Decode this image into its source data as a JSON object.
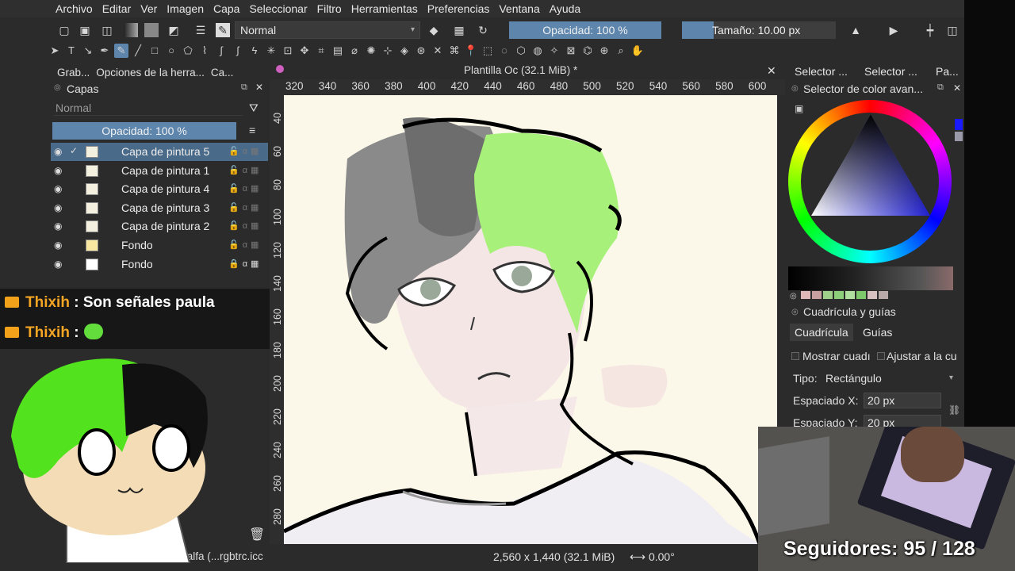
{
  "menu": [
    "Archivo",
    "Editar",
    "Ver",
    "Imagen",
    "Capa",
    "Seleccionar",
    "Filtro",
    "Herramientas",
    "Preferencias",
    "Ventana",
    "Ayuda"
  ],
  "toolbar": {
    "blend_mode": "Normal",
    "opacity_label": "Opacidad: 100 %",
    "size_label": "Tamaño: 10.00 px"
  },
  "left_tabs": [
    "Grab...",
    "Opciones de la herra...",
    "Ca..."
  ],
  "layers": {
    "title": "Capas",
    "blend_mode": "Normal",
    "opacity_label": "Opacidad:  100 %",
    "items": [
      {
        "name": "Capa de pintura 5",
        "selected": true
      },
      {
        "name": "Capa de pintura 1",
        "selected": false
      },
      {
        "name": "Capa de pintura 4",
        "selected": false
      },
      {
        "name": "Capa de pintura 3",
        "selected": false
      },
      {
        "name": "Capa de pintura 2",
        "selected": false
      },
      {
        "name": "Fondo",
        "selected": false
      },
      {
        "name": "Fondo",
        "selected": false
      }
    ]
  },
  "chat": [
    {
      "user": "Thixih",
      "message": " : Son señales paula"
    },
    {
      "user": "Thixih",
      "message": " :"
    }
  ],
  "document": {
    "tab_title": "Plantilla Oc (32.1 MiB) *",
    "ruler_top": [
      "320",
      "340",
      "360",
      "380",
      "400",
      "420",
      "440",
      "460",
      "480",
      "500",
      "520",
      "540",
      "560",
      "580",
      "600"
    ],
    "ruler_left": [
      "40",
      "60",
      "80",
      "100",
      "120",
      "140",
      "160",
      "180",
      "200",
      "220",
      "240",
      "260",
      "280"
    ]
  },
  "status": {
    "color_profile": "B/alfa (...rgbtrc.icc",
    "dimensions": "2,560 x 1,440 (32.1 MiB)",
    "rotation": "0.00°"
  },
  "right_tabs": [
    "Selector ...",
    "Selector ...",
    "Pa..."
  ],
  "color_selector": {
    "title": "Selector de color avan...",
    "swatches": [
      "#e0b8b8",
      "#c8a0a0",
      "#9fd08a",
      "#8ccf7a",
      "#b0e0a0",
      "#7dc86a",
      "#d8c0c0",
      "#b8a8a8"
    ]
  },
  "grid": {
    "title": "Cuadrícula y guías",
    "tabs": [
      "Cuadrícula",
      "Guías"
    ],
    "show_label": "Mostrar cuadı",
    "snap_label": "Ajustar a la cu",
    "type_label": "Tipo:",
    "type_value": "Rectángulo",
    "spacing_x_label": "Espaciado X:",
    "spacing_x_value": "20 px",
    "spacing_y_label": "Espaciado Y:",
    "spacing_y_value": "20 px"
  },
  "overlay": {
    "followers": "Seguidores: 95 / 128"
  },
  "colors": {
    "accent": "#5e86ad",
    "hair_green": "#a7f07a",
    "panel": "#2b2b2b",
    "canvas": "#fcf8e9"
  }
}
